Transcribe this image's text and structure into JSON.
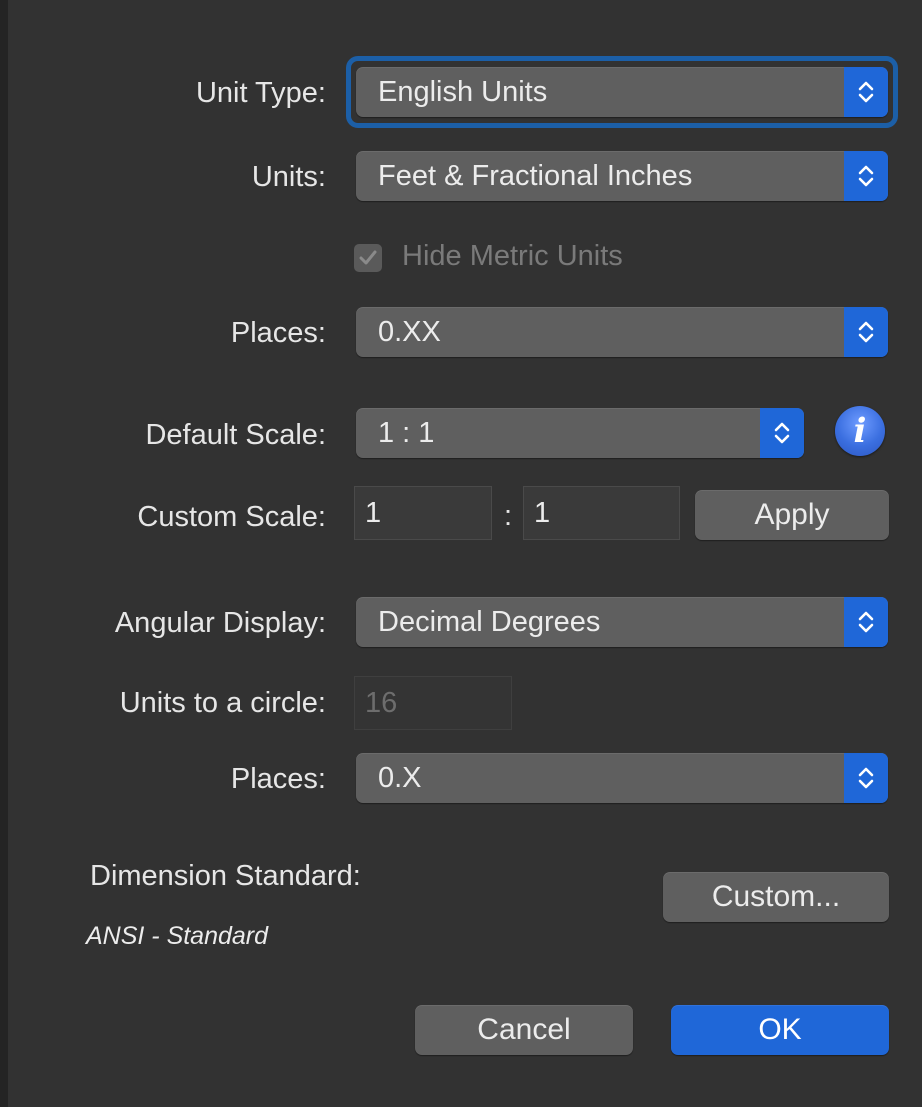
{
  "dialog": {
    "unit_type": {
      "label": "Unit Type:",
      "value": "English Units"
    },
    "units": {
      "label": "Units:",
      "value": "Feet & Fractional Inches"
    },
    "hide_metric": {
      "label": "Hide Metric Units",
      "checked": true,
      "enabled": false
    },
    "places": {
      "label": "Places:",
      "value": "0.XX"
    },
    "default_scale": {
      "label": "Default Scale:",
      "value": "1 : 1",
      "info_glyph": "i"
    },
    "custom_scale": {
      "label": "Custom Scale:",
      "left_value": "1",
      "separator": ":",
      "right_value": "1",
      "apply_label": "Apply"
    },
    "angular_display": {
      "label": "Angular Display:",
      "value": "Decimal Degrees"
    },
    "units_to_circle": {
      "label": "Units to a circle:",
      "value": "16",
      "enabled": false
    },
    "angular_places": {
      "label": "Places:",
      "value": "0.X"
    },
    "dimension_standard": {
      "label": "Dimension Standard:",
      "value": "ANSI - Standard",
      "custom_label": "Custom..."
    },
    "cancel_label": "Cancel",
    "ok_label": "OK"
  },
  "icons": {
    "stepper": "chevron-up-down-icon",
    "checkbox": "checkmark-icon",
    "info": "info-icon"
  },
  "colors": {
    "window_bg": "#323232",
    "control_bg": "#5f5f5f",
    "accent": "#1f67d8",
    "focus_ring": "#1c5fa7",
    "text": "#e6e6e6",
    "disabled_text": "#6d6d6d"
  }
}
